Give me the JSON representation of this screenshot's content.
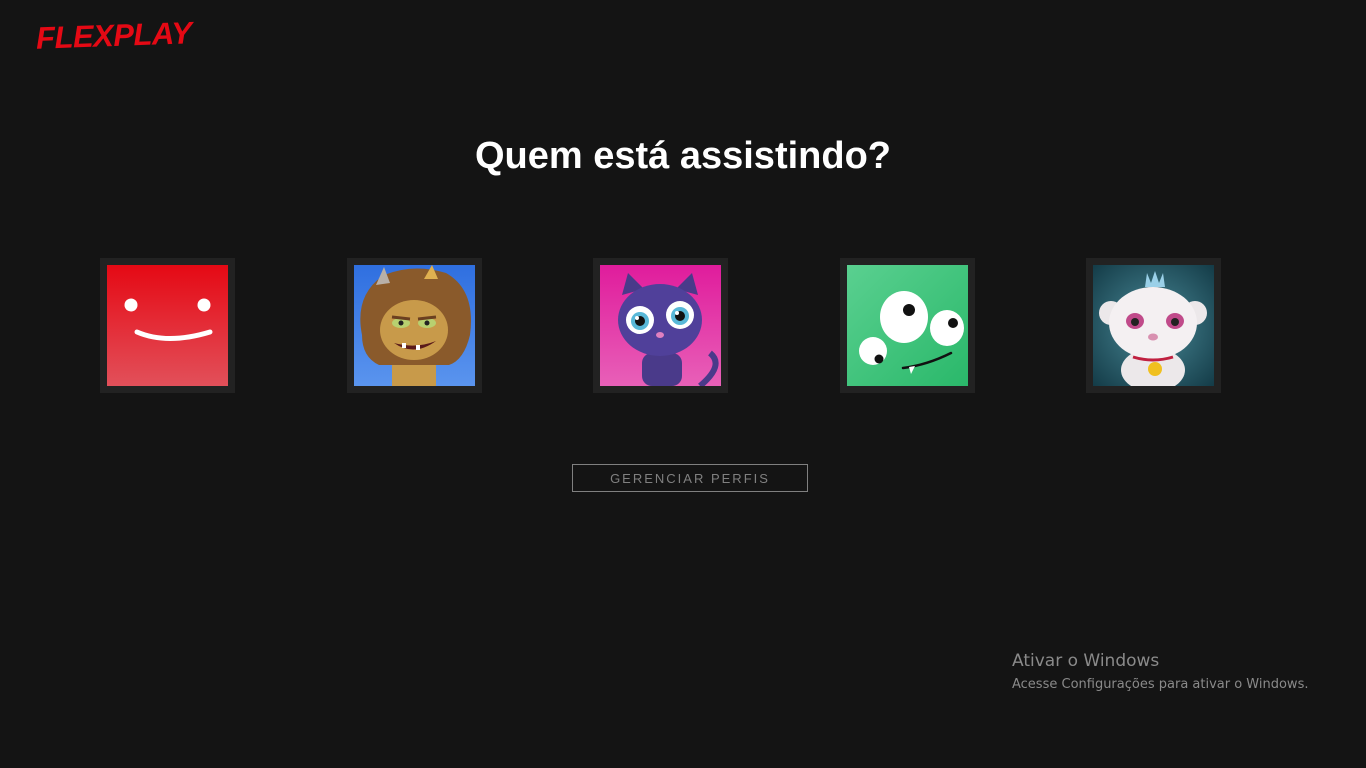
{
  "brand": {
    "name": "FLEXPLAY",
    "color": "#e50914"
  },
  "heading": "Quem está assistindo?",
  "profiles": [
    {
      "avatar": "red-smiley-avatar",
      "bg": "#e50914"
    },
    {
      "avatar": "hairy-monster-avatar",
      "bg": "#3d7be0"
    },
    {
      "avatar": "purple-cat-avatar",
      "bg": "#e0249a"
    },
    {
      "avatar": "green-alien-avatar",
      "bg": "#3fcf80"
    },
    {
      "avatar": "white-bear-avatar",
      "bg": "#1f4f5c"
    }
  ],
  "manage_button": "GERENCIAR PERFIS",
  "windows_notice": {
    "title": "Ativar o Windows",
    "subtitle": "Acesse Configurações para ativar o Windows."
  }
}
